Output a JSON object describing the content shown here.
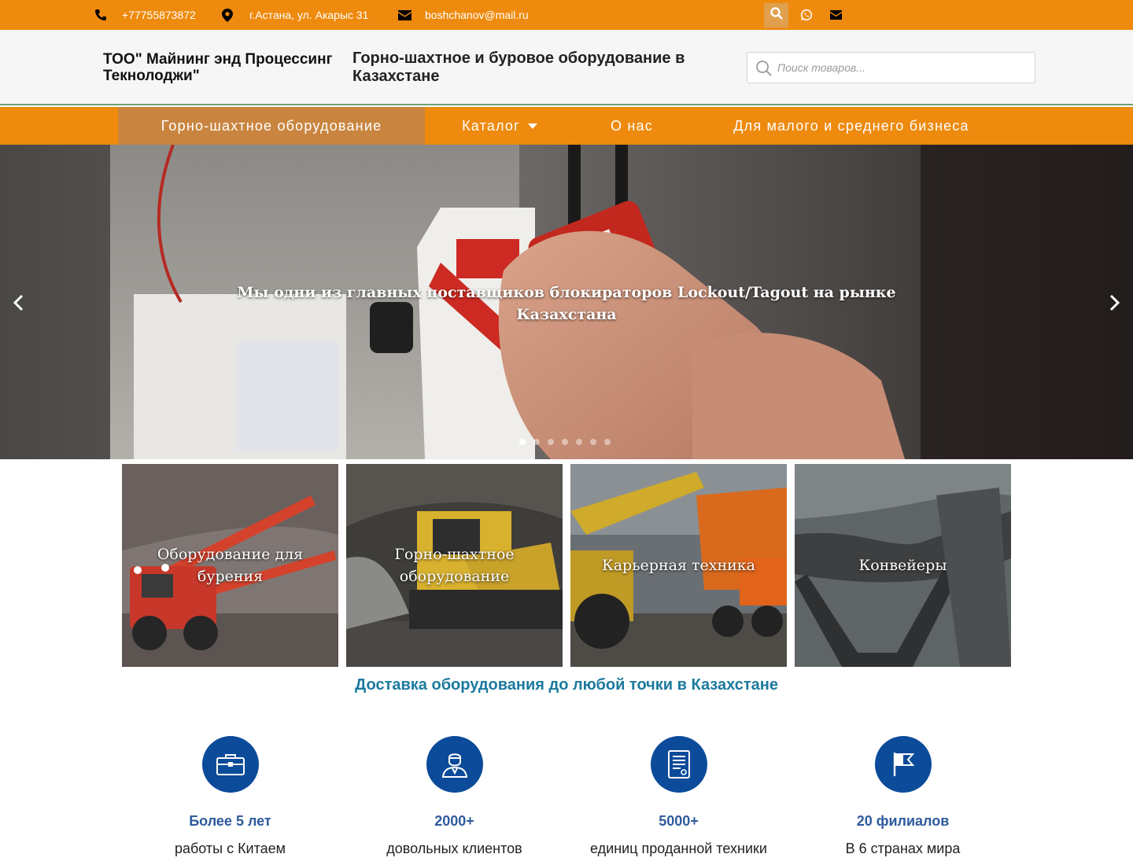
{
  "topbar": {
    "phone": "+77755873872",
    "address": "г.Астана, ул. Акарыс 31",
    "email": "boshchanov@mail.ru",
    "icons": [
      "phone-icon",
      "map-marker-icon",
      "envelope-icon",
      "search-icon",
      "whatsapp-icon",
      "envelope-icon"
    ]
  },
  "header": {
    "company_name": "ТОО\" Майнинг энд Процессинг Текнолоджи\"",
    "tagline": "Горно-шахтное и буровое оборудование в Казахстане",
    "search_placeholder": "Поиск товаров..."
  },
  "nav": {
    "items": [
      {
        "label": "Горно-шахтное оборудование",
        "active": true
      },
      {
        "label": "Каталог",
        "has_dropdown": true
      },
      {
        "label": "О нас"
      },
      {
        "label": "Для малого и среднего бизнеса"
      }
    ]
  },
  "hero": {
    "title": "Мы одни из главных поставщиков блокираторов Lockout/Tagout на рынке Казахстана",
    "slide_count": 7,
    "active_slide": 1
  },
  "categories": [
    {
      "label": "Оборудование для бурения"
    },
    {
      "label": "Горно-шахтное оборудование"
    },
    {
      "label": "Карьерная техника"
    },
    {
      "label": "Конвейеры"
    }
  ],
  "delivery_text": "Доставка оборудования до любой точки в Казахстане",
  "features": [
    {
      "icon": "briefcase-icon",
      "title": "Более 5 лет",
      "subtitle": "работы с Китаем"
    },
    {
      "icon": "user-icon",
      "title": "2000+",
      "subtitle": "довольных клиентов"
    },
    {
      "icon": "document-icon",
      "title": "5000+",
      "subtitle": "единиц проданной техники"
    },
    {
      "icon": "flag-icon",
      "title": "20 филиалов",
      "subtitle": "В 6 странах мира"
    }
  ],
  "colors": {
    "orange": "#ee8a0d",
    "nav_active": "#c9853f",
    "feature_blue": "#0b4b9a",
    "delivery_blue": "#1b7a9e"
  }
}
